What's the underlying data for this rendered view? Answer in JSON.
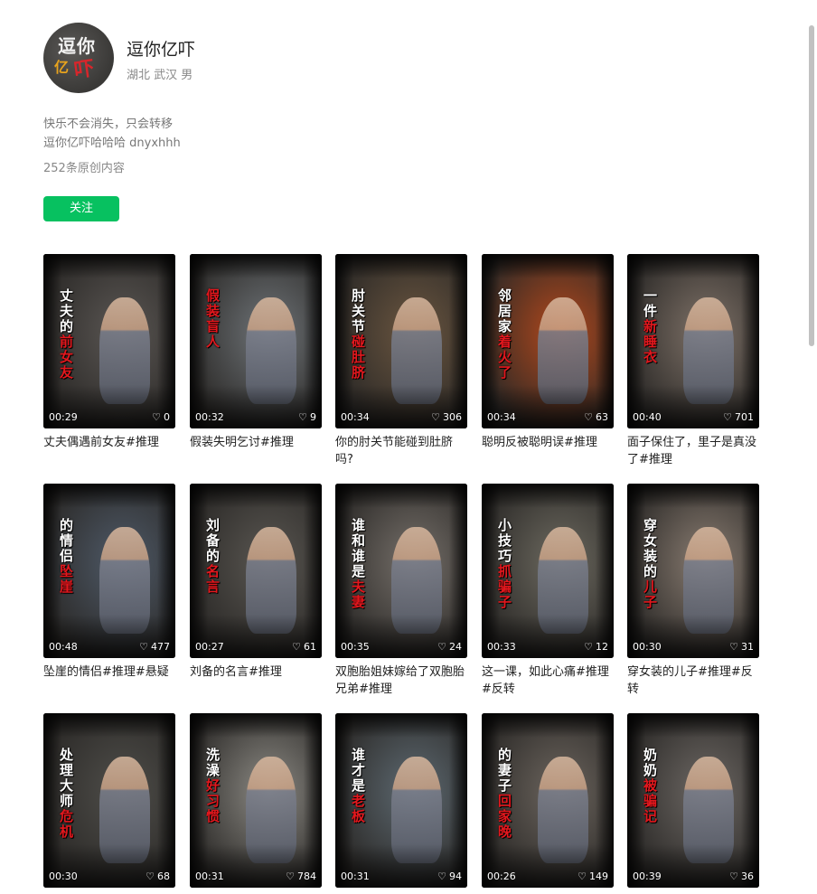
{
  "profile": {
    "name": "逗你亿吓",
    "location": "湖北 武汉 男",
    "avatar_text_top": "逗你",
    "avatar_text_left": "亿",
    "avatar_text_right": "吓",
    "bio_line1": "快乐不会消失，只会转移",
    "bio_line2": "逗你亿吓哈哈哈 dnyxhhh",
    "original_count": "252条原创内容",
    "follow_label": "关注",
    "follow_color": "#07c160"
  },
  "videos": [
    {
      "duration": "00:29",
      "likes": "0",
      "title": "丈夫偶遇前女友#推理",
      "caption_white": "丈夫的",
      "caption_red": "前女友",
      "tone": "#5b5754"
    },
    {
      "duration": "00:32",
      "likes": "9",
      "title": "假装失明乞讨#推理",
      "caption_white": "",
      "caption_red": "假装盲人",
      "tone": "#6f7478"
    },
    {
      "duration": "00:34",
      "likes": "306",
      "title": "你的肘关节能碰到肚脐吗?",
      "caption_white": "肘关节",
      "caption_red": "碰肚脐",
      "tone": "#6b5640"
    },
    {
      "duration": "00:34",
      "likes": "63",
      "title": "聪明反被聪明误#推理",
      "caption_white": "邻居家",
      "caption_red": "着火了",
      "tone": "#b2481c"
    },
    {
      "duration": "00:40",
      "likes": "701",
      "title": "面子保住了，里子是真没了#推理",
      "caption_white": "一件",
      "caption_red": "新睡衣",
      "tone": "#7f7268"
    },
    {
      "duration": "00:48",
      "likes": "477",
      "title": "坠崖的情侣#推理#悬疑",
      "caption_white": "的情侣",
      "caption_red": "坠崖",
      "tone": "#4f5a68"
    },
    {
      "duration": "00:27",
      "likes": "61",
      "title": "刘备的名言#推理",
      "caption_white": "刘备的",
      "caption_red": "名言",
      "tone": "#5a5752"
    },
    {
      "duration": "00:35",
      "likes": "24",
      "title": "双胞胎姐妹嫁给了双胞胎兄弟#推理",
      "caption_white": "谁和谁是",
      "caption_red": "夫妻",
      "tone": "#76706a"
    },
    {
      "duration": "00:33",
      "likes": "12",
      "title": "这一课，如此心痛#推理#反转",
      "caption_white": "小技巧",
      "caption_red": "抓骗子",
      "tone": "#6d6a60"
    },
    {
      "duration": "00:30",
      "likes": "31",
      "title": "穿女装的儿子#推理#反转",
      "caption_white": "穿女装的",
      "caption_red": "儿子",
      "tone": "#8a7d72"
    },
    {
      "duration": "00:30",
      "likes": "68",
      "title": "",
      "caption_white": "处理大师",
      "caption_red": "危机",
      "tone": "#4f4e4a"
    },
    {
      "duration": "00:31",
      "likes": "784",
      "title": "",
      "caption_white": "洗澡",
      "caption_red": "好习惯",
      "tone": "#8c8a84"
    },
    {
      "duration": "00:31",
      "likes": "94",
      "title": "",
      "caption_white": "谁才是",
      "caption_red": "老板",
      "tone": "#5e6a72"
    },
    {
      "duration": "00:26",
      "likes": "149",
      "title": "",
      "caption_white": "的妻子",
      "caption_red": "回家晚",
      "tone": "#6c655e"
    },
    {
      "duration": "00:39",
      "likes": "36",
      "title": "",
      "caption_white": "奶奶",
      "caption_red": "被骗记",
      "tone": "#6d6864"
    }
  ]
}
